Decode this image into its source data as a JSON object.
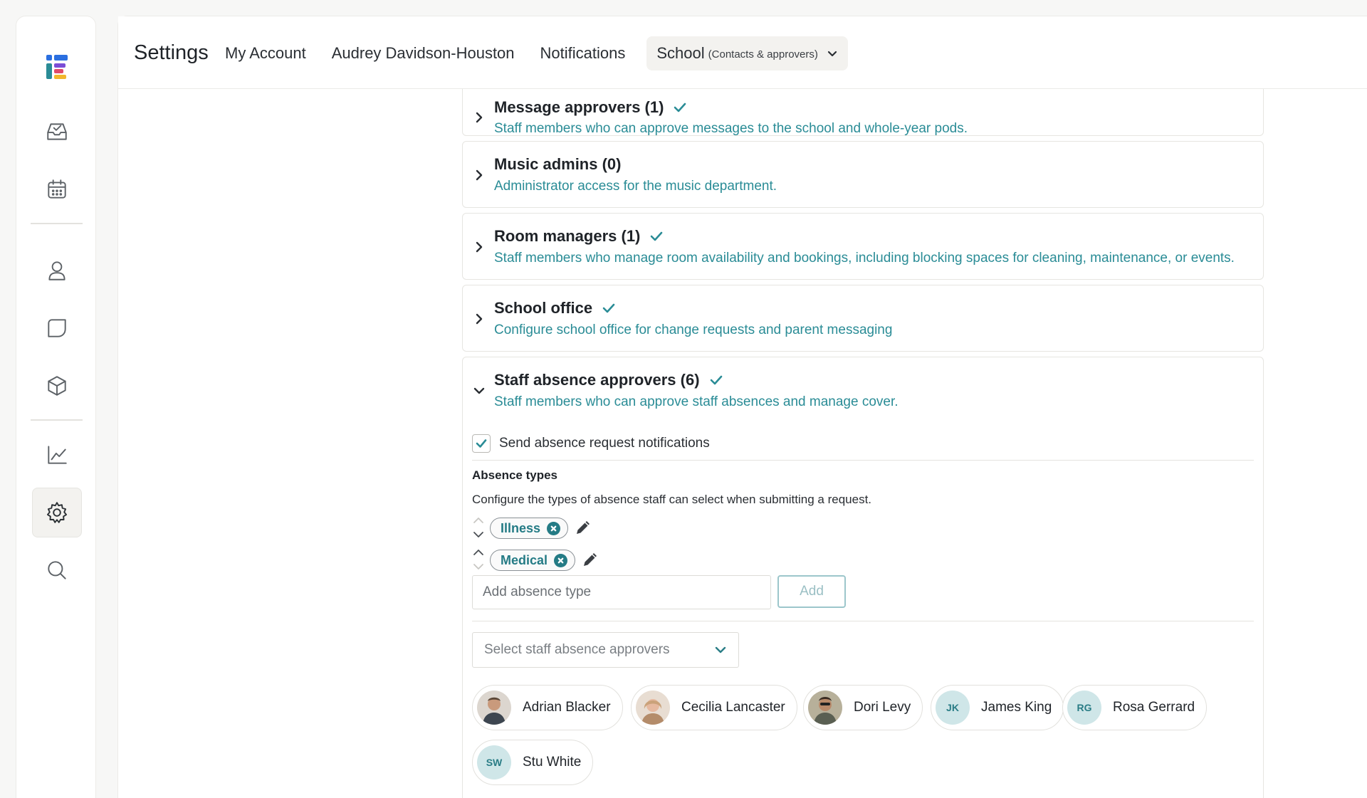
{
  "app": {
    "title": "Settings"
  },
  "nav": {
    "tabs": [
      {
        "label": "My Account"
      },
      {
        "label": "Audrey Davidson-Houston"
      },
      {
        "label": "Notifications"
      }
    ],
    "selected": {
      "label": "School",
      "sub": "(Contacts & approvers)"
    }
  },
  "rail": {
    "icons": [
      "logo",
      "inbox-check-icon",
      "calendar-icon",
      "person-icon",
      "chat-icon",
      "cube-icon",
      "chart-icon",
      "gear-icon",
      "search-icon"
    ],
    "active": "gear-icon"
  },
  "sections": [
    {
      "title": "Message approvers (1)",
      "desc": "Staff members who can approve messages to the school and whole-year pods.",
      "checked": true,
      "expanded": false
    },
    {
      "title": "Music admins (0)",
      "desc": "Administrator access for the music department.",
      "checked": false,
      "expanded": false
    },
    {
      "title": "Room managers (1)",
      "desc": "Staff members who manage room availability and bookings, including blocking spaces for cleaning, maintenance, or events.",
      "checked": true,
      "expanded": false
    },
    {
      "title": "School office",
      "desc": "Configure school office for change requests and parent messaging",
      "checked": true,
      "expanded": false
    },
    {
      "title": "Staff absence approvers (6)",
      "desc": "Staff members who can approve staff absences and manage cover.",
      "checked": true,
      "expanded": true
    }
  ],
  "staff_absence": {
    "notify_label": "Send absence request notifications",
    "notify_checked": true,
    "types_title": "Absence types",
    "types_desc": "Configure the types of absence staff can select when submitting a request.",
    "types": [
      {
        "label": "Illness"
      },
      {
        "label": "Medical"
      }
    ],
    "add_placeholder": "Add absence type",
    "add_label": "Add",
    "select_placeholder": "Select staff absence approvers",
    "approvers": [
      {
        "name": "Adrian Blacker",
        "avatar": "photo"
      },
      {
        "name": "Cecilia Lancaster",
        "avatar": "photo"
      },
      {
        "name": "Dori Levy",
        "avatar": "photo"
      },
      {
        "name": "James King",
        "initials": "JK"
      },
      {
        "name": "Rosa Gerrard",
        "initials": "RG"
      },
      {
        "name": "Stu White",
        "initials": "SW"
      }
    ]
  },
  "colors": {
    "accent": "#2a8c96",
    "tag": "#247b85",
    "avatar_bg": "#cfe6e8"
  }
}
